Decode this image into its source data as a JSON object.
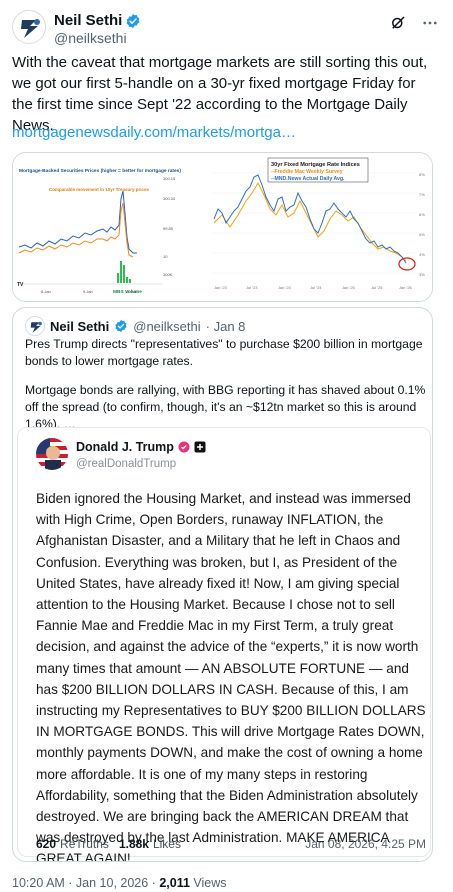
{
  "author": {
    "name": "Neil Sethi",
    "handle": "@neilksethi"
  },
  "tweet": {
    "text": "With the caveat that mortgage markets are still sorting this out, we got our first 5-handle on a 30-yr fixed mortgage Friday for the first time since Sept '22 according to the Mortgage Daily News.",
    "link": "mortgagenewsdaily.com/markets/mortga…"
  },
  "chart1": {
    "title": "Mortgage-Backed Securities Prices (higher = better for mortgage rates)",
    "annotation": "Comparable movement in 10yr Treasury prices",
    "vol_label": "MBS Volume",
    "y_ticks": [
      "100.15",
      "100.00",
      "99.85",
      "10",
      "100K"
    ],
    "x_ticks": [
      "8.Jan",
      "9.Jan",
      "12.Jan"
    ]
  },
  "chart2": {
    "title": "30yr Fixed Mortgage Rate Indices",
    "legend": [
      "--Freddie Mac Weekly Survey",
      "--MND.News Actual Daily Avg."
    ],
    "y_ticks": [
      "8%",
      "7%",
      "6%",
      "5%",
      "4%",
      "3%"
    ],
    "x_ticks": [
      "Jan '23",
      "Jul '23",
      "Jan '24",
      "Jul '24",
      "Jan '25",
      "Jul '25",
      "Jan '26"
    ],
    "series": [
      {
        "name": "Freddie Mac Weekly Survey",
        "color": "#f5a300"
      },
      {
        "name": "MND.News Actual Daily Avg.",
        "color": "#2f6ec9"
      }
    ]
  },
  "quote": {
    "name": "Neil Sethi",
    "handle": "@neilksethi",
    "date": "· Jan 8",
    "text1": "Pres Trump directs \"representatives\" to purchase $200 billion in mortgage bonds to lower mortgage rates.",
    "text2": "Mortgage bonds are rallying, with BBG reporting it has shaved about 0.1% off the spread (to confirm, though, it's an ~$12tn market so this is around 1.6%). …"
  },
  "truth": {
    "name": "Donald J. Trump",
    "handle": "@realDonaldTrump",
    "body": "Biden ignored the Housing Market, and instead was immersed with High Crime, Open Borders, runaway INFLATION, the Afghanistan Disaster, and a Military that he left in Chaos and Confusion. Everything was broken, but I, as President of the United States, have already fixed it! Now, I am giving special attention to the Housing Market. Because I chose not to sell Fannie Mae and Freddie Mac in my First Term, a truly great decision, and against the advice of the “experts,” it is now worth many times that amount — AN ABSOLUTE FORTUNE — and has $200 BILLION DOLLARS IN CASH. Because of this, I am instructing my Representatives to BUY $200 BILLION DOLLARS IN MORTGAGE BONDS. This will drive Mortgage Rates DOWN, monthly payments DOWN, and make the cost of owning a home more affordable. It is one of my many steps in restoring Affordability, something that the Biden Administration absolutely destroyed. We are bringing back the AMERICAN DREAM that was destroyed by the last Administration. MAKE AMERICA GREAT AGAIN!",
    "retruths_count": "620",
    "retruths_label": "ReTruths",
    "likes_count": "1.88k",
    "likes_label": "Likes",
    "date": "Jan 08, 2026, 4:25 PM"
  },
  "footer": {
    "time": "10:20 AM · Jan 10, 2026 · ",
    "views_count": "2,011",
    "views_label": "Views"
  },
  "colors": {
    "verified_blue": "#1d9bf0",
    "link": "#1d9bf0"
  }
}
